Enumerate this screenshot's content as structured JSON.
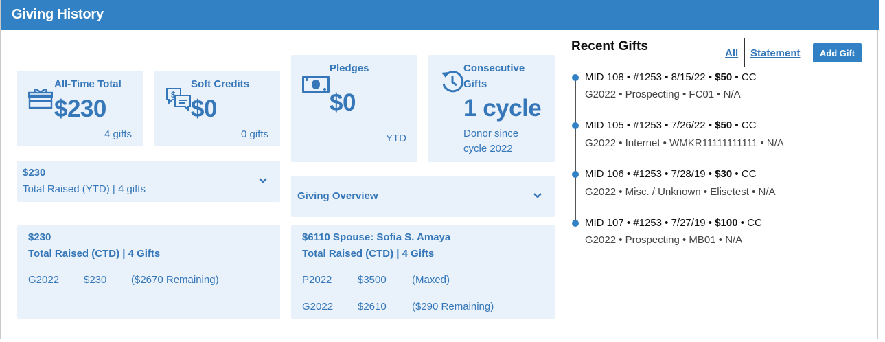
{
  "header": {
    "title": "Giving History"
  },
  "stats": {
    "all_time": {
      "label": "All-Time Total",
      "value": "$230",
      "sub": "4 gifts"
    },
    "soft_credits": {
      "label": "Soft Credits",
      "value": "$0",
      "sub": "0 gifts"
    },
    "pledges": {
      "label": "Pledges",
      "value": "$0",
      "sub": "YTD"
    },
    "consecutive": {
      "label_line1": "Consecutive",
      "label_line2": "Gifts",
      "value": "1 cycle",
      "sub_line1": "Donor since",
      "sub_line2": "cycle 2022"
    }
  },
  "ytd": {
    "amount": "$230",
    "summary": "Total Raised (YTD) | 4 gifts"
  },
  "overview": {
    "label": "Giving Overview"
  },
  "ctd_self": {
    "amount": "$230",
    "summary": "Total Raised (CTD) | 4 Gifts",
    "rows": [
      {
        "cycle": "G2022",
        "amount": "$230",
        "status": "($2670 Remaining)"
      }
    ]
  },
  "ctd_spouse": {
    "amount": "$6110 Spouse: Sofia S. Amaya",
    "summary": "Total Raised (CTD) | 4 Gifts",
    "rows": [
      {
        "cycle": "P2022",
        "amount": "$3500",
        "status": "(Maxed)"
      },
      {
        "cycle": "G2022",
        "amount": "$2610",
        "status": "($290 Remaining)"
      }
    ]
  },
  "recent": {
    "title": "Recent Gifts",
    "all_link": "All",
    "statement_link": "Statement",
    "add_button": "Add Gift",
    "gifts": [
      {
        "pre": "MID 108 • #1253 • 8/15/22 • ",
        "amount": "$50",
        "post": " • CC",
        "line2": "G2022 • Prospecting • FC01 • N/A"
      },
      {
        "pre": "MID 105 • #1253 • 7/26/22 • ",
        "amount": "$50",
        "post": " • CC",
        "line2": "G2022 • Internet • WMKR11111111111 • N/A"
      },
      {
        "pre": "MID 106 • #1253 • 7/28/19 • ",
        "amount": "$30",
        "post": " • CC",
        "line2": "G2022 • Misc. / Unknown • Elisetest • N/A"
      },
      {
        "pre": "MID 107 • #1253 • 7/27/19 • ",
        "amount": "$100",
        "post": " • CC",
        "line2": "G2022 • Prospecting • MB01 • N/A"
      }
    ]
  },
  "colors": {
    "header": "#3181c4",
    "card": "#e9f1fa",
    "accent": "#3577b8"
  },
  "icons": [
    "gift-icon",
    "chat-dollar-icon",
    "cash-icon",
    "history-icon",
    "chevron-down-icon"
  ]
}
